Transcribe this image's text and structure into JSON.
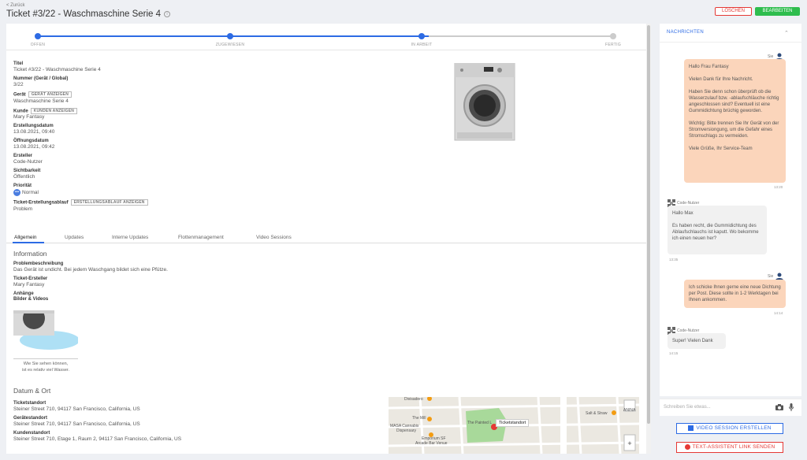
{
  "header": {
    "back_label": "< Zurück",
    "title": "Ticket #3/22 - Waschmaschine Serie 4",
    "delete_label": "LÖSCHEN",
    "edit_label": "BEARBEITEN"
  },
  "progress": {
    "steps": [
      "OFFEN",
      "ZUGEWIESEN",
      "IN ARBEIT",
      "FERTIG"
    ],
    "active_color": "#2d6be4",
    "inactive_color": "#cccccc"
  },
  "fields": {
    "titel_label": "Titel",
    "titel_value": "Ticket #3/22 - Waschmaschine Serie 4",
    "nummer_label": "Nummer (Gerät / Global)",
    "nummer_value": "3/22",
    "geraet_label": "Gerät",
    "geraet_button": "GERÄT ANZEIGEN",
    "geraet_value": "Waschmaschine Serie 4",
    "kunde_label": "Kunde",
    "kunde_button": "KUNDEN ANZEIGEN",
    "kunde_value": "Mary Fantasy",
    "erstellungsdatum_label": "Erstellungsdatum",
    "erstellungsdatum_value": "13.08.2021, 09:40",
    "oeffnungsdatum_label": "Öffnungsdatum",
    "oeffnungsdatum_value": "13.08.2021, 09:42",
    "ersteller_label": "Ersteller",
    "ersteller_value": "Code-Nutzer",
    "sichtbarkeit_label": "Sichtbarkeit",
    "sichtbarkeit_value": "Öffentlich",
    "prioritaet_label": "Priorität",
    "prioritaet_value": "Normal",
    "ablauf_label": "Ticket-Erstellungsablauf",
    "ablauf_button": "ERSTELLUNGSABLAUF ANZEIGEN",
    "ablauf_value": "Problem"
  },
  "tabs": [
    "Allgemein",
    "Updates",
    "Interne Updates",
    "Flottenmanagement",
    "Video Sessions"
  ],
  "information": {
    "title": "Information",
    "problem_label": "Problembeschreibung",
    "problem_value": "Das Gerät ist undicht. Bei jedem Waschgang bildet sich eine Pfütze.",
    "ersteller_label": "Ticket-Ersteller",
    "ersteller_value": "Mary Fantasy",
    "anhaenge_label": "Anhänge",
    "bilder_label": "Bilder & Videos",
    "caption_line1": "Wie Sie sehen können,",
    "caption_line2": "ist es relativ viel Wasser."
  },
  "datum_ort": {
    "title": "Datum & Ort",
    "ticket_label": "Ticketstandort",
    "ticket_value": "Steiner Street 710, 94117 San Francisco, California, US",
    "geraet_label": "Gerätestandort",
    "geraet_value": "Steiner Street 710, 94117 San Francisco, California, US",
    "kunden_label": "Kundenstandort",
    "kunden_value": "Steiner Street 710, Etage 1, Raum 2, 94117 San Francisco, California, US"
  },
  "map": {
    "tooltip": "Ticketstandort",
    "labels": [
      "Divisadero",
      "The Mill",
      "The Painted L",
      "MASA Cannabis",
      "Dispensary",
      "Emporium SF",
      "Arcade Bar Venue",
      "Salt & Straw",
      "ANINA"
    ]
  },
  "chat": {
    "header": "NACHRICHTEN",
    "sie_label": "Sie",
    "bot_label": "Code-Nutzer",
    "msg1": "Hallo Frau Fantasy\n\nVielen Dank für Ihre Nachricht.\n\nHaben Sie denn schon überprüft ob die Wasserzulauf bzw. -ablaufschläuche richtig angeschlossen sind? Eventuell ist eine Gummidichtung brüchig geworden.\n\nWichtig: Bitte trennen Sie Ihr Gerät von der Stromversiongung, um die Gefahr eines Stromschlags zu vermeiden.\n\nViele Grüße, Ihr Service-Team",
    "msg1_time": "13:20",
    "msg2": "Hallo Max\n\nEs haben recht, die Gummidichtung des Ablaufschlauchs ist kaputt. Wo bekomme ich einen neuen her?",
    "msg2_time": "13:35",
    "msg3": "Ich schicke Ihnen gerne eine neue Dichtung per Post. Diese sollte in 1-2 Werktagen bei Ihnen ankommen.",
    "msg3_time": "14:14",
    "msg4": "Super! Vielen Dank",
    "msg4_time": "14:15",
    "input_placeholder": "Schreiben Sie etwas..."
  },
  "actions": {
    "video_label": "VIDEO SESSION ERSTELLEN",
    "text_label": "TEXT-ASSISTENT LINK SENDEN"
  }
}
